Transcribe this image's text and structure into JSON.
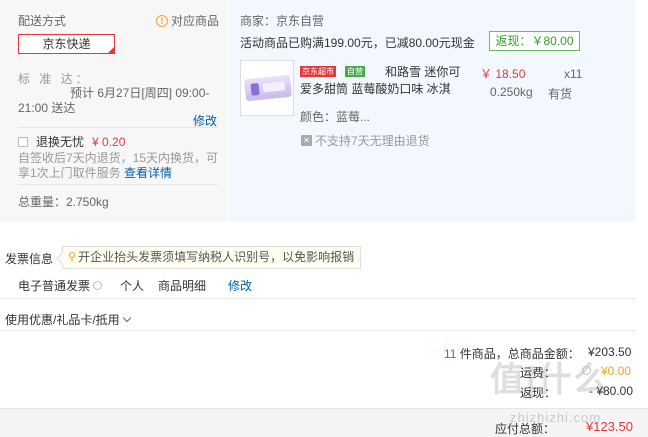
{
  "shipping": {
    "title": "配送方式",
    "match_link": "对应商品",
    "express": "京东快递",
    "standard_label": "标 准 达：",
    "standard_time": "预计 6月27日[周四] 09:00-21:00 送达",
    "modify": "修改",
    "return_option": "退换无忧",
    "return_price": "¥ 0.20",
    "return_desc": "自签收后7天内退货，15天内换货，可享1次上门取件服务",
    "return_detail_link": "查看详情",
    "total_weight": "总重量：2.750kg"
  },
  "order": {
    "seller": "商家：京东自营",
    "promo": "活动商品已购满199.00元，已减80.00元现金",
    "rebate_tag": "返现：￥80.00",
    "product": {
      "badge_supermarket": "京东超市",
      "badge_green": "自营",
      "name": "和路雪 迷你可爱多甜筒 蓝莓酸奶口味 冰淇",
      "price": "￥ 18.50",
      "qty": "x11",
      "weight": "0.250kg",
      "stock": "有货",
      "color": "颜色：蓝莓...",
      "no_return": "不支持7天无理由退货"
    }
  },
  "invoice": {
    "title": "发票信息",
    "tip": "开企业抬头发票须填写纳税人识别号，以免影响报销",
    "type": "电子普通发票",
    "person": "个人",
    "detail": "商品明细",
    "modify": "修改"
  },
  "coupon": {
    "label": "使用优惠/礼品卡/抵用"
  },
  "summary": {
    "count": "11",
    "count_suffix": " 件商品，总商品金额：",
    "total": "¥203.50",
    "ship_fee_label": "运费：",
    "ship_fee": "¥0.00",
    "rebate_label": "返现：",
    "rebate": "- ¥80.00",
    "pay_label": "应付总额：",
    "pay_total": "¥123.50"
  },
  "watermark": {
    "main": "值|什么",
    "sub": "zhizhizhi.com"
  },
  "colors": {
    "accent_red": "#e4393c",
    "link_blue": "#005ea7",
    "rebate_green": "#3a9a2a"
  }
}
